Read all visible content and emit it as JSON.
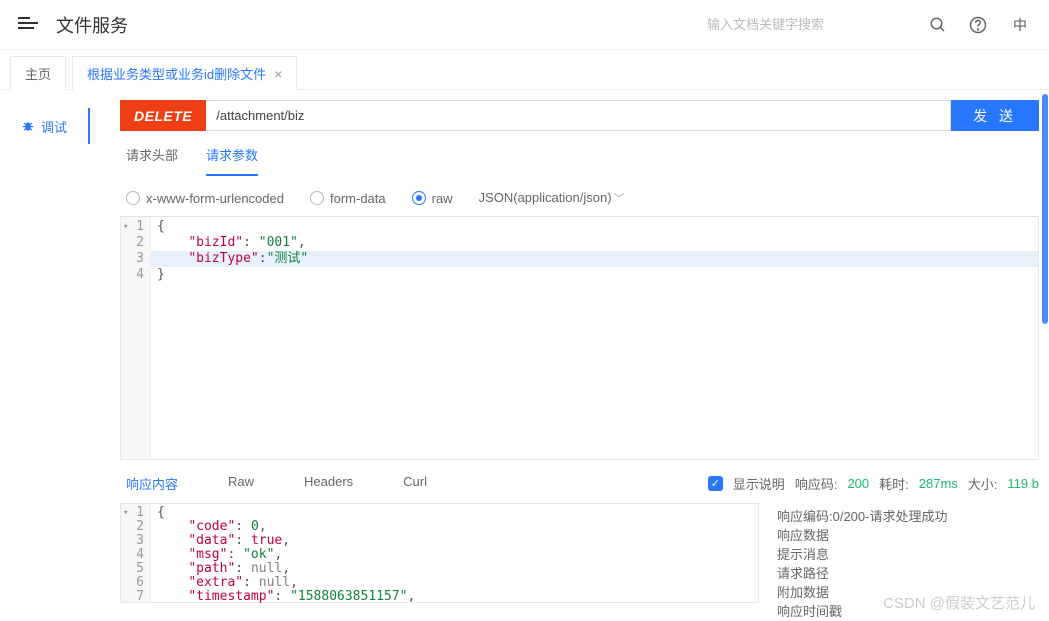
{
  "header": {
    "title": "文件服务",
    "search_placeholder": "输入文档关键字搜索",
    "lang": "中"
  },
  "page_tabs": {
    "home": "主页",
    "active_label": "根据业务类型或业务id删除文件"
  },
  "sidebar": {
    "debug": "调试"
  },
  "request": {
    "method": "DELETE",
    "path": "/attachment/biz",
    "send": "发 送"
  },
  "req_subtabs": {
    "headers": "请求头部",
    "params": "请求参数"
  },
  "bodytypes": {
    "form_url": "x-www-form-urlencoded",
    "form_data": "form-data",
    "raw": "raw",
    "content_type": "JSON(application/json)"
  },
  "req_body": {
    "lines": [
      {
        "n": "1",
        "fold": true,
        "t": "{"
      },
      {
        "n": "2",
        "t": "    \"bizId\": \"001\","
      },
      {
        "n": "3",
        "hl": true,
        "t": "    \"bizType\":\"测试\""
      },
      {
        "n": "4",
        "t": "}"
      }
    ],
    "json_pairs": [
      {
        "k": "bizId",
        "v": "001",
        "comma": true,
        "sp": true
      },
      {
        "k": "bizType",
        "v": "测试",
        "comma": false,
        "sp": false
      }
    ]
  },
  "resp_tabs": {
    "content": "响应内容",
    "raw": "Raw",
    "headers": "Headers",
    "curl": "Curl"
  },
  "resp_meta": {
    "show_desc": "显示说明",
    "code_label": "响应码:",
    "code_val": "200",
    "time_label": "耗时:",
    "time_val": "287ms",
    "size_label": "大小:",
    "size_val": "119 b"
  },
  "resp_body": {
    "line1_n": "1",
    "line1": "{",
    "pairs": [
      {
        "n": "2",
        "k": "code",
        "type": "num",
        "v": "0",
        "comma": true
      },
      {
        "n": "3",
        "k": "data",
        "type": "bool",
        "v": "true",
        "comma": true
      },
      {
        "n": "4",
        "k": "msg",
        "type": "str",
        "v": "ok",
        "comma": true
      },
      {
        "n": "5",
        "k": "path",
        "type": "null",
        "v": "null",
        "comma": true
      },
      {
        "n": "6",
        "k": "extra",
        "type": "null",
        "v": "null",
        "comma": true
      },
      {
        "n": "7",
        "k": "timestamp",
        "type": "str",
        "v": "1588063851157",
        "comma": true
      }
    ]
  },
  "resp_desc": [
    "响应编码:0/200-请求处理成功",
    "响应数据",
    "提示消息",
    "请求路径",
    "附加数据",
    "响应时间戳"
  ],
  "watermark": "CSDN @假装文艺范儿"
}
